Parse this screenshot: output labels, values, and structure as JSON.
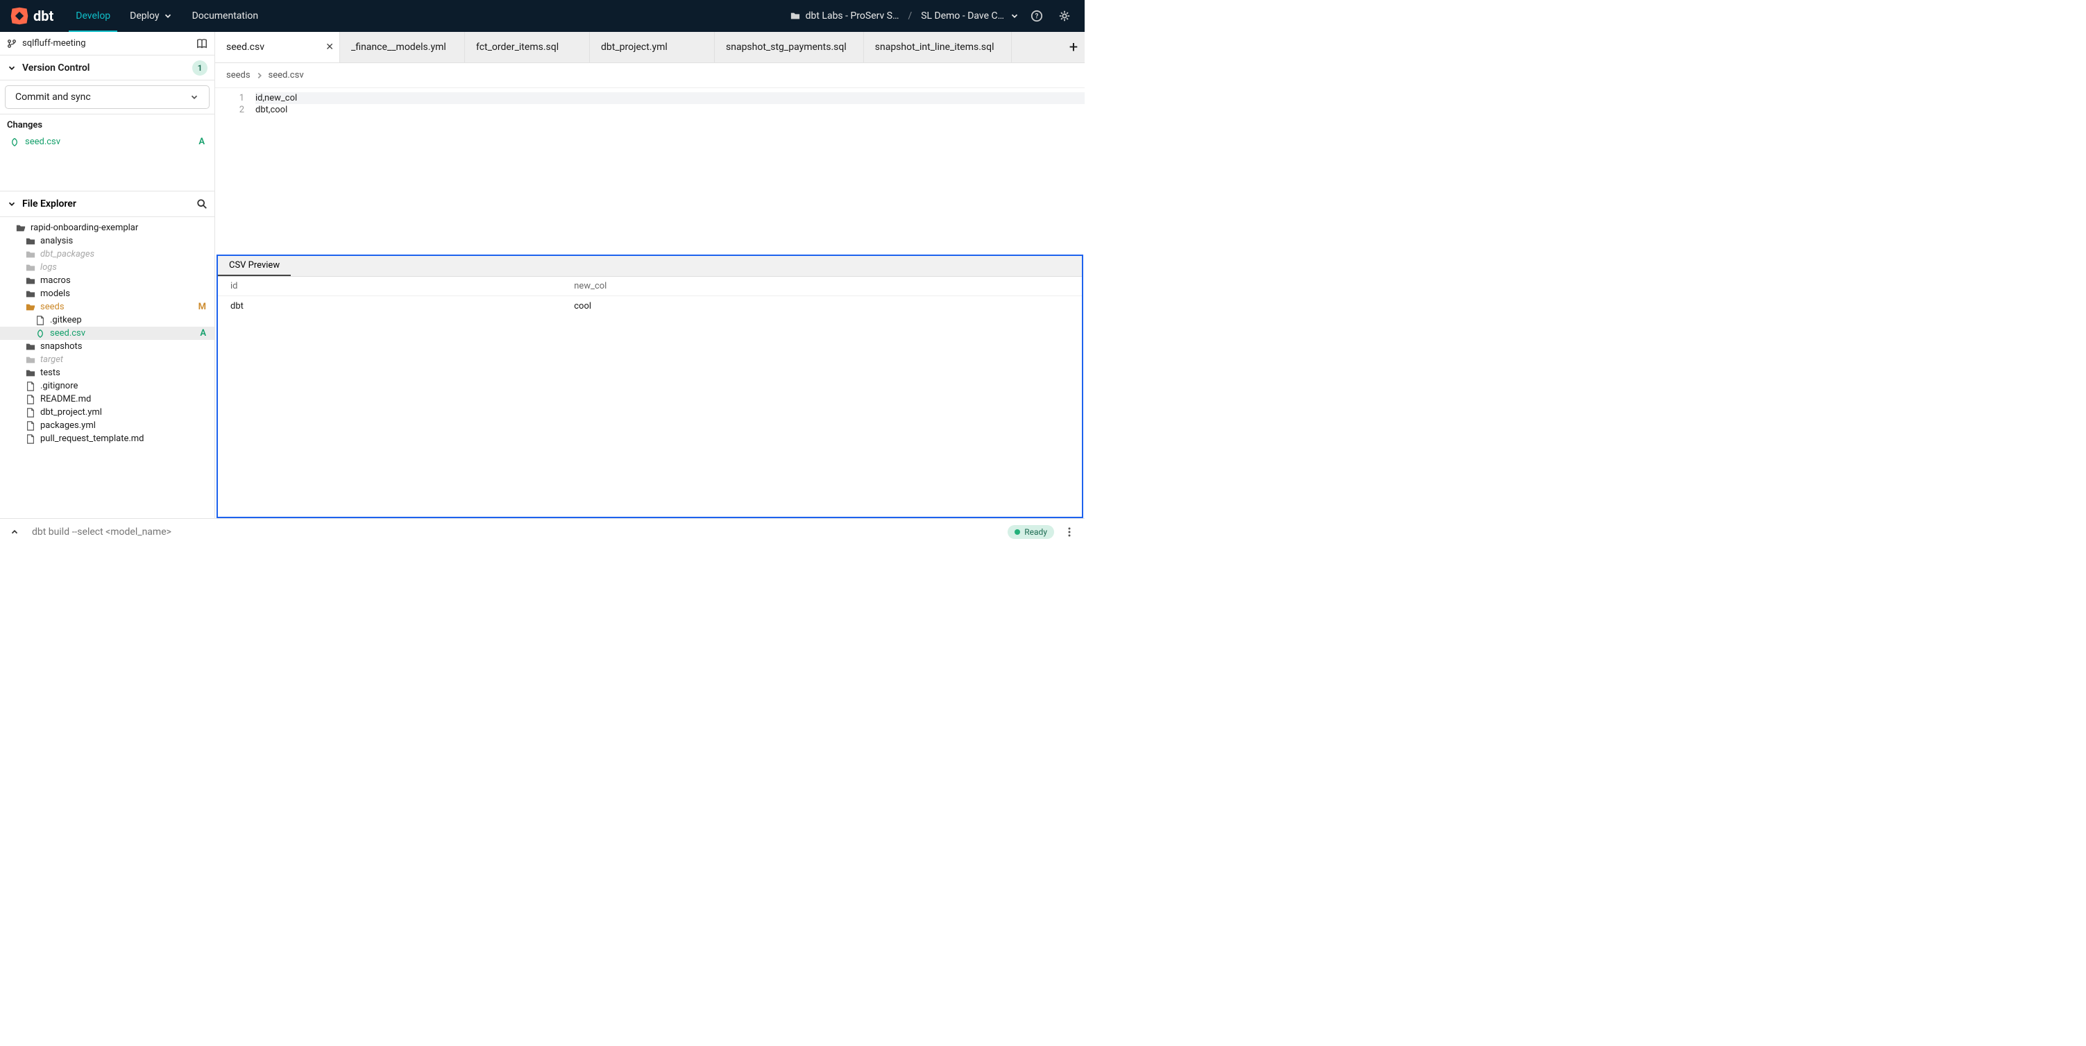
{
  "nav": {
    "logo_text": "dbt",
    "links": [
      "Develop",
      "Deploy",
      "Documentation"
    ],
    "active_index": 0,
    "org": "dbt Labs - ProServ S…",
    "project": "SL Demo - Dave C…"
  },
  "sidebar": {
    "branch": "sqlfluff-meeting",
    "vc_title": "Version Control",
    "vc_count": "1",
    "commit_label": "Commit and sync",
    "changes_label": "Changes",
    "changes": [
      {
        "name": "seed.csv",
        "status": "A"
      }
    ],
    "fe_title": "File Explorer",
    "tree": [
      {
        "depth": 0,
        "icon": "folder-open",
        "label": "rapid-onboarding-exemplar"
      },
      {
        "depth": 1,
        "icon": "folder",
        "label": "analysis"
      },
      {
        "depth": 1,
        "icon": "folder",
        "label": "dbt_packages",
        "dim": true
      },
      {
        "depth": 1,
        "icon": "folder",
        "label": "logs",
        "dim": true
      },
      {
        "depth": 1,
        "icon": "folder",
        "label": "macros"
      },
      {
        "depth": 1,
        "icon": "folder",
        "label": "models"
      },
      {
        "depth": 1,
        "icon": "folder-open",
        "label": "seeds",
        "color": "orange",
        "status": "M"
      },
      {
        "depth": 2,
        "icon": "file",
        "label": ".gitkeep"
      },
      {
        "depth": 2,
        "icon": "seed",
        "label": "seed.csv",
        "color": "green",
        "status": "A",
        "sel": true
      },
      {
        "depth": 1,
        "icon": "folder",
        "label": "snapshots"
      },
      {
        "depth": 1,
        "icon": "folder",
        "label": "target",
        "dim": true
      },
      {
        "depth": 1,
        "icon": "folder",
        "label": "tests"
      },
      {
        "depth": 1,
        "icon": "file",
        "label": ".gitignore"
      },
      {
        "depth": 1,
        "icon": "file",
        "label": "README.md"
      },
      {
        "depth": 1,
        "icon": "file",
        "label": "dbt_project.yml"
      },
      {
        "depth": 1,
        "icon": "file",
        "label": "packages.yml"
      },
      {
        "depth": 1,
        "icon": "file",
        "label": "pull_request_template.md"
      }
    ]
  },
  "tabs": [
    {
      "label": "seed.csv",
      "active": true
    },
    {
      "label": "_finance__models.yml"
    },
    {
      "label": "fct_order_items.sql"
    },
    {
      "label": "dbt_project.yml"
    },
    {
      "label": "snapshot_stg_payments.sql"
    },
    {
      "label": "snapshot_int_line_items.sql"
    }
  ],
  "breadcrumb": [
    "seeds",
    "seed.csv"
  ],
  "code": {
    "lines": [
      "id,new_col",
      "dbt,cool"
    ]
  },
  "preview": {
    "tab_label": "CSV Preview",
    "headers": [
      "id",
      "new_col"
    ],
    "rows": [
      [
        "dbt",
        "cool"
      ]
    ]
  },
  "cmdbar": {
    "placeholder": "dbt build --select <model_name>",
    "status": "Ready"
  }
}
